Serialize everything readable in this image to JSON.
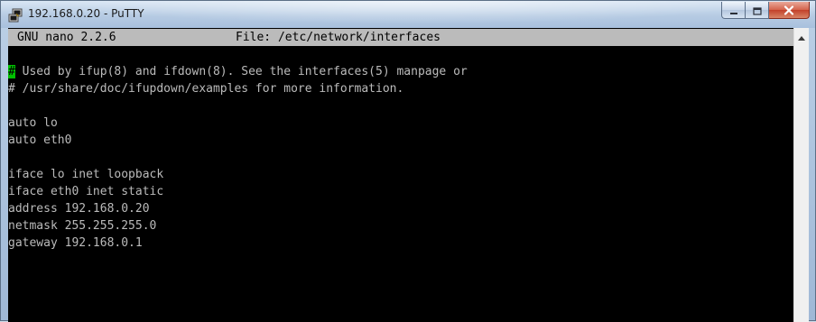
{
  "window": {
    "title": "192.168.0.20 - PuTTY"
  },
  "icons": {
    "app": "putty-icon",
    "minimize": "minimize-icon",
    "maximize": "maximize-icon",
    "close": "close-icon",
    "scroll_up": "scroll-up-arrow-icon"
  },
  "colors": {
    "terminal_bg": "#000000",
    "terminal_fg": "#bbbbbb",
    "header_bg": "#bbbbbb",
    "cursor": "#00c000",
    "close_button": "#c7452f"
  },
  "nano": {
    "version": "GNU nano 2.2.6",
    "file_label": "File: /etc/network/interfaces"
  },
  "editor": {
    "cursor_char": "#",
    "line1_rest": " Used by ifup(8) and ifdown(8). See the interfaces(5) manpage or",
    "line2": "# /usr/share/doc/ifupdown/examples for more information.",
    "line3": "",
    "line4": "auto lo",
    "line5": "auto eth0",
    "line6": "",
    "line7": "iface lo inet loopback",
    "line8": "iface eth0 inet static",
    "line9": "address 192.168.0.20",
    "line10": "netmask 255.255.255.0",
    "line11": "gateway 192.168.0.1"
  }
}
